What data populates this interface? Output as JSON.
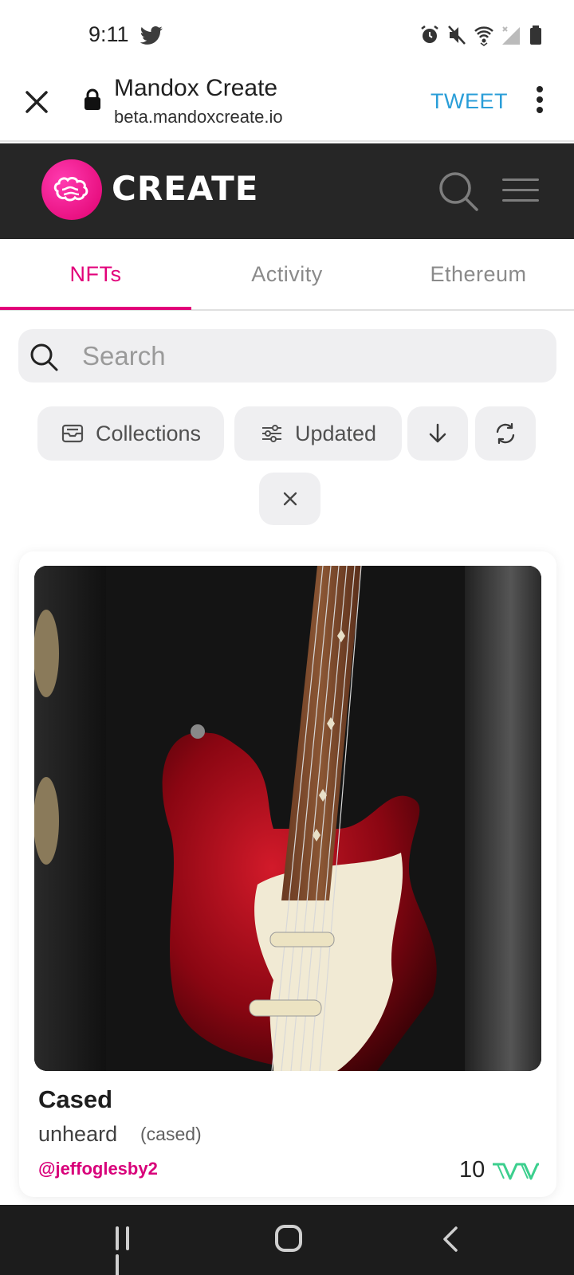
{
  "status_bar": {
    "time": "9:11",
    "icons": [
      "twitter-icon",
      "alarm-icon",
      "mute-icon",
      "wifi-icon",
      "signal-icon",
      "battery-icon"
    ]
  },
  "browser": {
    "site_title": "Mandox Create",
    "url": "beta.mandoxcreate.io",
    "tweet_label": "TWEET"
  },
  "app_header": {
    "brand_name": "CREATE"
  },
  "tabs": [
    {
      "label": "NFTs",
      "active": true
    },
    {
      "label": "Activity",
      "active": false
    },
    {
      "label": "Ethereum",
      "active": false
    }
  ],
  "search": {
    "placeholder": "Search"
  },
  "filters": {
    "collections_label": "Collections",
    "sort_label": "Updated"
  },
  "nft_card": {
    "title": "Cased",
    "collection": "unheard",
    "collection_tag": "(cased)",
    "owner": "@jeffoglesby2",
    "price": "10"
  },
  "colors": {
    "accent": "#e2007a",
    "header_bg": "#262626",
    "tweet": "#2a9ed8",
    "price_logo": "#3ccf8e"
  }
}
